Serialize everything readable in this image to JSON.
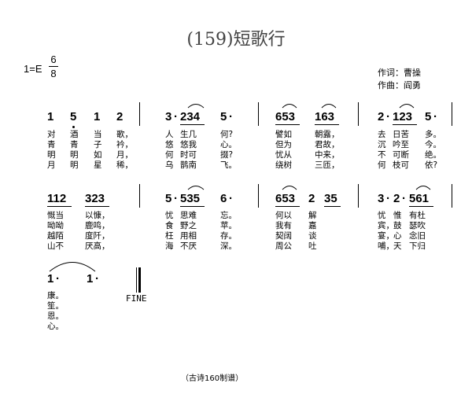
{
  "title": "(159)短歌行",
  "key": {
    "left": "1=E",
    "num": "6",
    "den": "8"
  },
  "credits": {
    "lyrics": "作词：曹操",
    "music": "作曲：阎勇"
  },
  "rows": [
    {
      "measures": [
        {
          "notes": [
            "1",
            "5",
            "1",
            "2"
          ]
        },
        {
          "notes": [
            "3",
            "·",
            "234",
            "5",
            "·"
          ]
        },
        {
          "notes": [
            "653",
            "163"
          ]
        },
        {
          "notes": [
            "2",
            "·",
            "123",
            "5",
            "·"
          ]
        }
      ],
      "lyrics": [
        [
          "对",
          "酒",
          "当",
          "歌，",
          "人",
          "生几",
          "何?",
          "譬如",
          "朝露，",
          "去",
          "日苦",
          "多。"
        ],
        [
          "青",
          "青",
          "子",
          "衿，",
          "悠",
          "悠我",
          "心。",
          "但为",
          "君故，",
          "沉",
          "吟至",
          "今。"
        ],
        [
          "明",
          "明",
          "如",
          "月，",
          "何",
          "时可",
          "掇?",
          "忧从",
          "中来，",
          "不",
          "可断",
          "绝。"
        ],
        [
          "月",
          "明",
          "星",
          "稀，",
          "乌",
          "鹊南",
          "飞。",
          "绕树",
          "三匝，",
          "何",
          "枝可",
          "依?"
        ]
      ]
    },
    {
      "measures": [
        {
          "notes": [
            "112",
            "323"
          ]
        },
        {
          "notes": [
            "5",
            "·",
            "535",
            "6",
            "·"
          ]
        },
        {
          "notes": [
            "653",
            "2",
            "35"
          ]
        },
        {
          "notes": [
            "3",
            "·",
            "2",
            "·",
            "561"
          ]
        }
      ],
      "lyrics": [
        [
          "慨当",
          "以慷，",
          "忧",
          "思难",
          "忘。",
          "何以",
          "解",
          "忧",
          "惟",
          "有杜"
        ],
        [
          "呦呦",
          "鹿鸣，",
          "食",
          "野之",
          "苹。",
          "我有",
          "嘉",
          "宾，",
          "鼓",
          "瑟吹"
        ],
        [
          "越陌",
          "度阡，",
          "枉",
          "用相",
          "存。",
          "契阔",
          "谈",
          "宴，",
          "心",
          "念旧"
        ],
        [
          "山不",
          "厌高，",
          "海",
          "不厌",
          "深。",
          "周公",
          "吐",
          "哺，",
          "天",
          "下归"
        ]
      ]
    },
    {
      "measures": [
        {
          "notes": [
            "1",
            "·",
            "1",
            "·"
          ]
        }
      ],
      "lyrics": [
        [
          "康。"
        ],
        [
          "笙。"
        ],
        [
          "恩。"
        ],
        [
          "心。"
        ]
      ],
      "fine": "FINE"
    }
  ],
  "footer": "（古诗160制谱）"
}
